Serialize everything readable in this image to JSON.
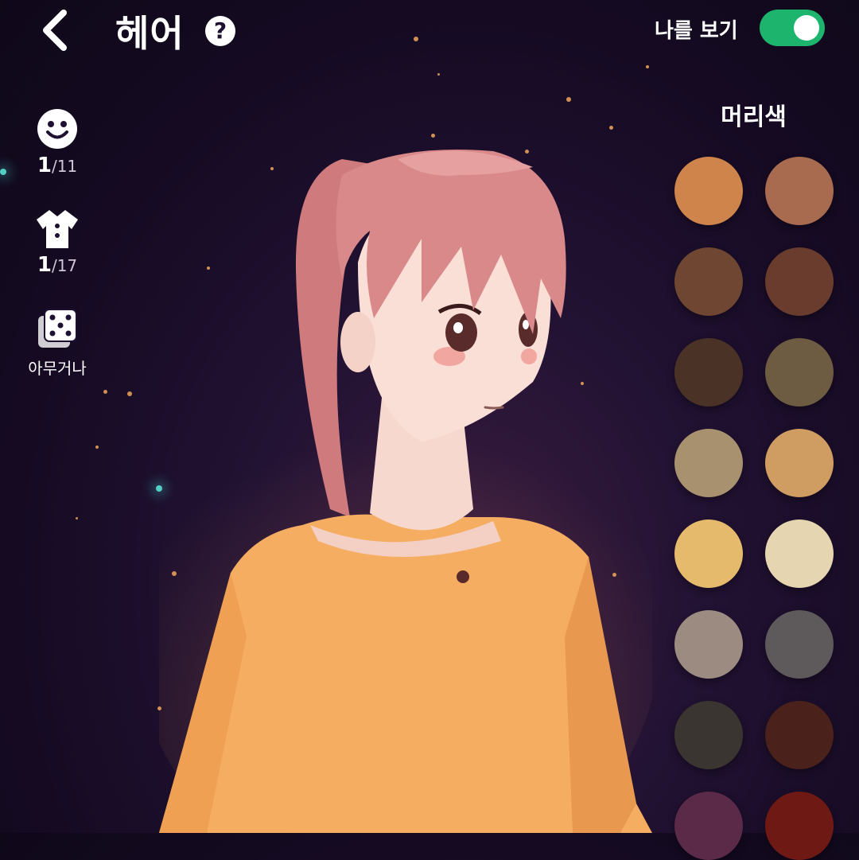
{
  "header": {
    "title": "헤어",
    "see_me_label": "나를 보기",
    "see_me_enabled": true
  },
  "rail": {
    "face": {
      "current": "1",
      "total": "/11"
    },
    "outfit": {
      "current": "1",
      "total": "/17"
    },
    "random": {
      "label": "아무거나"
    }
  },
  "hair_color": {
    "title": "머리색",
    "swatches": [
      "#cf844c",
      "#a86b4f",
      "#6f4631",
      "#6a3c2e",
      "#4a3326",
      "#6e5c42",
      "#a8916f",
      "#cf9d62",
      "#e6ba6c",
      "#e5d6b1",
      "#9b8b80",
      "#5e5a5b",
      "#3b3531",
      "#4a211b",
      "#5a2a48",
      "#6f1915"
    ]
  },
  "colors": {
    "toggle_on": "#1db56d",
    "shirt": "#f5ad62",
    "hair": "#d98989"
  }
}
